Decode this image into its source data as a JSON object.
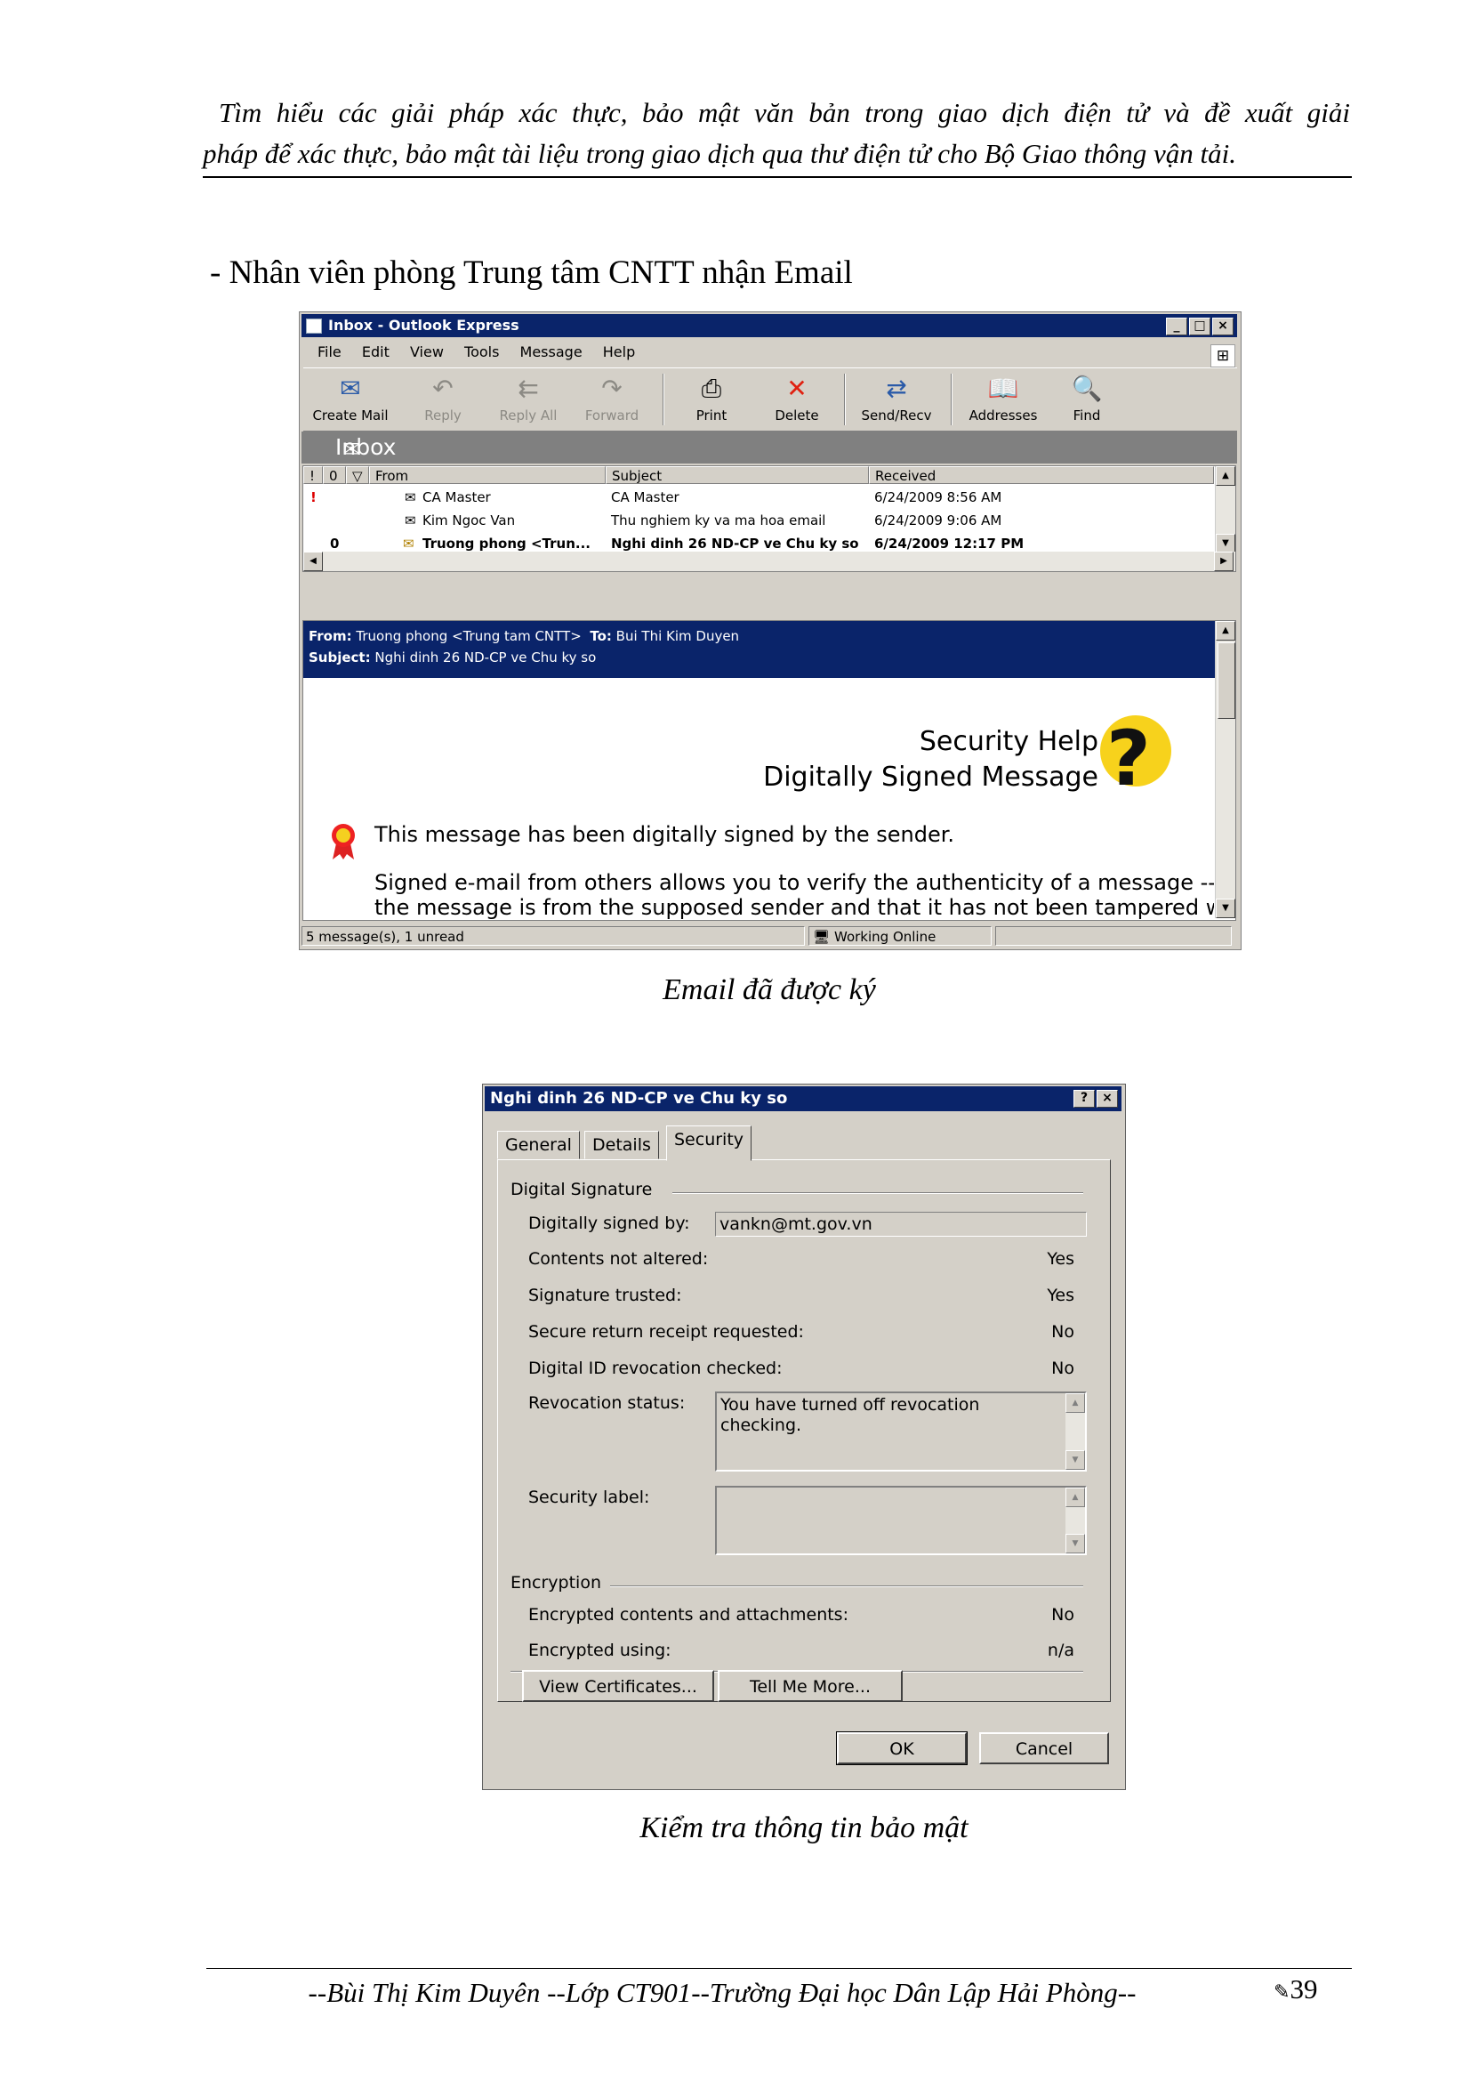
{
  "page": {
    "header_line1": "Tìm hiểu các giải pháp xác thực, bảo mật văn bản trong giao dịch điện tử và đề xuất giải",
    "header_line2": "pháp để xác thực, bảo mật tài liệu trong giao dịch qua thư điện tử cho Bộ Giao thông vận tải.",
    "intro": "- Nhân viên phòng Trung tâm CNTT nhận Email",
    "caption1": "Email đã được ký",
    "caption2": "Kiểm tra thông tin bảo mật",
    "footer": "--Bùi Thị Kim Duyên --Lớp CT901--Trường Đại học Dân Lập Hải Phòng--",
    "page_number": "39"
  },
  "outlook": {
    "title": "Inbox - Outlook Express",
    "menu": [
      "File",
      "Edit",
      "View",
      "Tools",
      "Message",
      "Help"
    ],
    "toolbar": [
      {
        "label": "Create Mail",
        "icon": "create-mail-icon",
        "enabled": true
      },
      {
        "label": "Reply",
        "icon": "reply-icon",
        "enabled": false
      },
      {
        "label": "Reply All",
        "icon": "reply-all-icon",
        "enabled": false
      },
      {
        "label": "Forward",
        "icon": "forward-icon",
        "enabled": false
      },
      {
        "label": "Print",
        "icon": "print-icon",
        "enabled": true
      },
      {
        "label": "Delete",
        "icon": "delete-icon",
        "enabled": true
      },
      {
        "label": "Send/Recv",
        "icon": "send-recv-icon",
        "enabled": true
      },
      {
        "label": "Addresses",
        "icon": "addresses-icon",
        "enabled": true
      },
      {
        "label": "Find",
        "icon": "find-icon",
        "enabled": true
      }
    ],
    "folder": "Inbox",
    "columns": {
      "priority": "!",
      "attachment": "0",
      "flag": "▽",
      "from": "From",
      "subject": "Subject",
      "received": "Received"
    },
    "messages": [
      {
        "priority": "!",
        "attach": "",
        "from": "CA Master",
        "subject": "CA Master",
        "received": "6/24/2009 8:56 AM",
        "unread": false
      },
      {
        "priority": "",
        "attach": "",
        "from": "Kim Ngoc Van",
        "subject": "Thu nghiem ky va ma hoa email",
        "received": "6/24/2009 9:06 AM",
        "unread": false
      },
      {
        "priority": "",
        "attach": "0",
        "from": "Truong phong <Trun...",
        "subject": "Nghi dinh 26 ND-CP ve Chu ky so",
        "received": "6/24/2009 12:17 PM",
        "unread": true
      }
    ],
    "preview": {
      "from_label": "From:",
      "from": "Truong phong <Trung tam CNTT>",
      "to_label": "To:",
      "to": "Bui Thi Kim Duyen",
      "subject_label": "Subject:",
      "subject": "Nghi dinh 26 ND-CP ve Chu ky so",
      "help_title": "Security Help",
      "help_subtitle": "Digitally Signed Message",
      "para1": "This message has been digitally signed by the sender.",
      "para2": "Signed e-mail from others allows you to verify the authenticity of a message -- that",
      "para3": "the message is from the supposed sender and that it has not been tampered with"
    },
    "status": {
      "count": "5 message(s), 1 unread",
      "online": "Working Online"
    }
  },
  "dialog": {
    "title": "Nghi dinh 26 ND-CP ve Chu ky so",
    "tabs": [
      "General",
      "Details",
      "Security"
    ],
    "active_tab": "Security",
    "digital_signature_group": "Digital Signature",
    "signed_by_label": "Digitally signed by:",
    "signed_by": "vankn@mt.gov.vn",
    "rows": [
      {
        "label": "Contents not altered:",
        "value": "Yes"
      },
      {
        "label": "Signature trusted:",
        "value": "Yes"
      },
      {
        "label": "Secure return receipt requested:",
        "value": "No"
      },
      {
        "label": "Digital ID revocation checked:",
        "value": "No"
      }
    ],
    "revocation_label": "Revocation status:",
    "revocation_text": "You have turned off revocation checking.",
    "security_label": "Security label:",
    "security_value": "",
    "encryption_group": "Encryption",
    "enc_rows": [
      {
        "label": "Encrypted contents and attachments:",
        "value": "No"
      },
      {
        "label": "Encrypted using:",
        "value": "n/a"
      }
    ],
    "view_cert": "View Certificates...",
    "tell_more": "Tell Me More...",
    "ok": "OK",
    "cancel": "Cancel"
  }
}
